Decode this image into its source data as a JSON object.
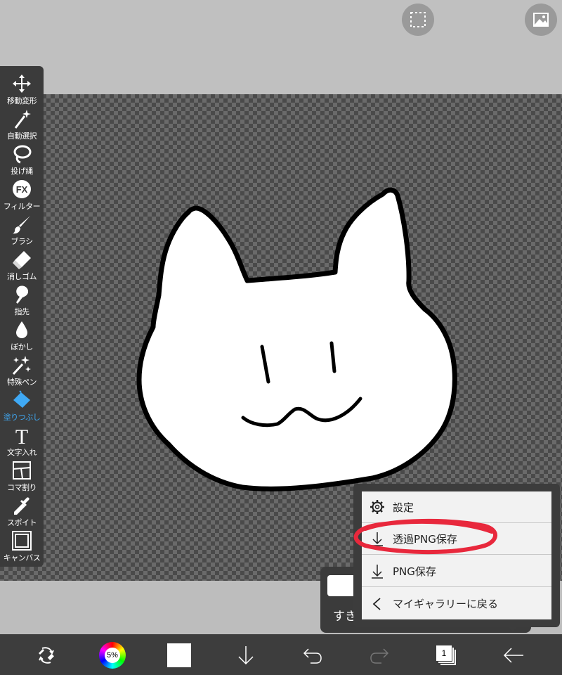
{
  "tools": [
    {
      "label": "移動変形",
      "icon": "move-icon"
    },
    {
      "label": "自動選択",
      "icon": "magic-wand-icon"
    },
    {
      "label": "投げ縄",
      "icon": "lasso-icon"
    },
    {
      "label": "フィルター",
      "icon": "fx-icon",
      "glyph": "FX"
    },
    {
      "label": "ブラシ",
      "icon": "brush-icon"
    },
    {
      "label": "消しゴム",
      "icon": "eraser-icon"
    },
    {
      "label": "指先",
      "icon": "finger-icon"
    },
    {
      "label": "ぼかし",
      "icon": "blur-drop-icon"
    },
    {
      "label": "特殊ペン",
      "icon": "sparkle-pen-icon"
    },
    {
      "label": "塗りつぶし",
      "icon": "bucket-icon",
      "active": true
    },
    {
      "label": "文字入れ",
      "icon": "text-icon",
      "glyph": "T"
    },
    {
      "label": "コマ割り",
      "icon": "frame-divide-icon"
    },
    {
      "label": "スポイト",
      "icon": "eyedropper-icon"
    },
    {
      "label": "キャンバス",
      "icon": "canvas-icon"
    }
  ],
  "brush_panel": {
    "text": "すき間"
  },
  "menu": {
    "items": [
      {
        "label": "設定",
        "icon": "gear-icon"
      },
      {
        "label": "透過PNG保存",
        "icon": "download-icon"
      },
      {
        "label": "PNG保存",
        "icon": "download-icon"
      },
      {
        "label": "マイギャラリーに戻る",
        "icon": "chevron-left-icon"
      }
    ]
  },
  "bottom": {
    "brush_size": "5%",
    "layer_count": "1"
  },
  "colors": {
    "active_tool": "#3fa9f5",
    "highlight_circle": "#e8283c",
    "toolbar_bg": "#3b3b3b"
  }
}
